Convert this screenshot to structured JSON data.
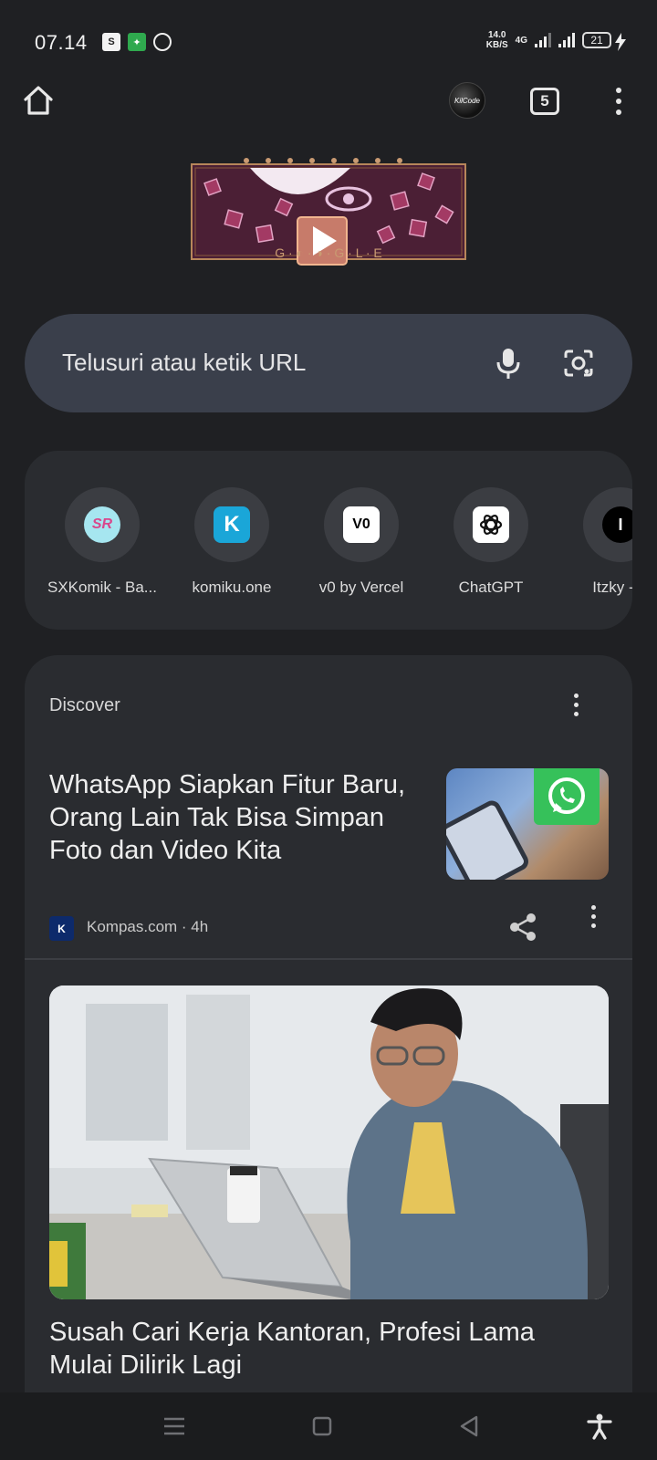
{
  "status_bar": {
    "time": "07.14",
    "net_speed_value": "14.0",
    "net_speed_unit": "KB/S",
    "network_type": "4G",
    "battery": "21"
  },
  "toolbar": {
    "tab_count": "5",
    "avatar_text": "KilCode"
  },
  "doodle": {
    "letters": "G · ◐ · ◑ · G · L · E"
  },
  "search": {
    "placeholder": "Telusuri atau ketik URL"
  },
  "shortcuts": [
    {
      "label": "SXKomik - Ba...",
      "icon": "sxkomik-icon",
      "glyph": "SR"
    },
    {
      "label": "komiku.one",
      "icon": "komiku-icon",
      "glyph": "K"
    },
    {
      "label": "v0 by Vercel",
      "icon": "v0-icon",
      "glyph": "V0"
    },
    {
      "label": "ChatGPT",
      "icon": "chatgpt-icon",
      "glyph": ""
    },
    {
      "label": "Itzky - P",
      "icon": "itzky-icon",
      "glyph": "I"
    }
  ],
  "discover": {
    "title": "Discover",
    "articles": [
      {
        "title": "WhatsApp Siapkan Fitur Baru, Orang Lain Tak Bisa Simpan Foto dan Video Kita",
        "source": "Kompas.com · 4h"
      },
      {
        "title": "Susah Cari Kerja Kantoran, Profesi Lama Mulai Dilirik Lagi"
      }
    ]
  },
  "colors": {
    "background": "#1f2023",
    "card": "#2a2c30",
    "search_bar": "#3a3f4b",
    "whatsapp_green": "#36c15a"
  }
}
